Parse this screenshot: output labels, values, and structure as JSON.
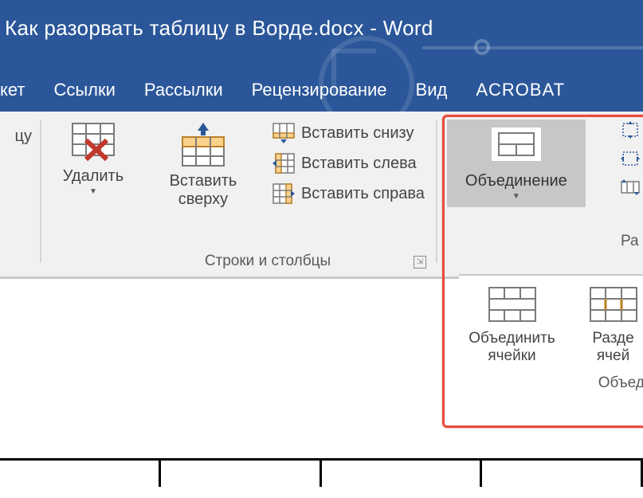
{
  "titlebar": {
    "document_title": "Как разорвать таблицу в Ворде.docx - Word"
  },
  "tabs": {
    "maket_partial": "кет",
    "links": "Ссылки",
    "mailings": "Рассылки",
    "review": "Рецензирование",
    "view": "Вид",
    "acrobat": "ACROBAT"
  },
  "ribbon": {
    "tsu_partial": "цу",
    "delete": "Удалить",
    "insert_above": "Вставить\nсверху",
    "insert_below": "Вставить снизу",
    "insert_left": "Вставить слева",
    "insert_right": "Вставить справа",
    "rows_cols_group": "Строки и столбцы",
    "merge_dropdown": "Объединение",
    "size_group_partial": "Ра",
    "merge_cells": "Объединить\nячейки",
    "split_cells_partial": "Разде\nячей",
    "merge_group_label_partial": "Объедин"
  }
}
